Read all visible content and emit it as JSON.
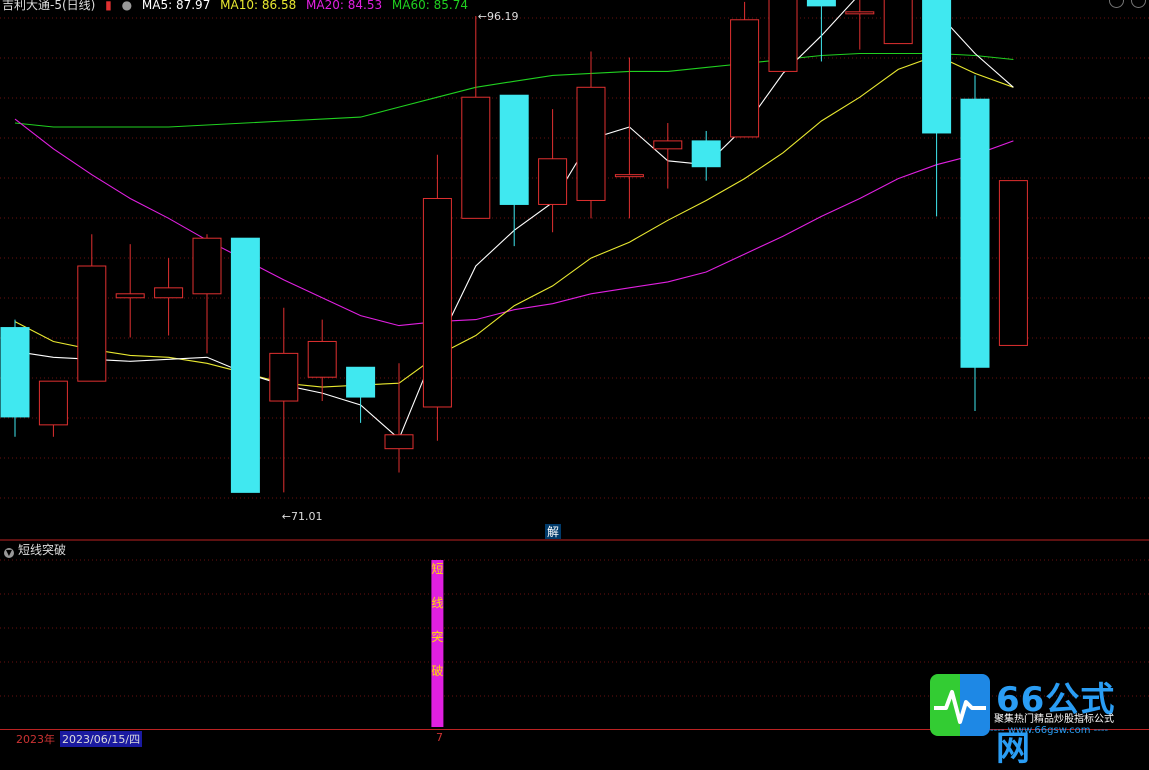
{
  "header": {
    "title": "吉利大通-5(日线)",
    "ma5": "MA5: 87.97",
    "ma10": "MA10: 86.58",
    "ma20": "MA20: 84.53",
    "ma60": "MA60: 85.74"
  },
  "colors": {
    "up": "#e03030",
    "down": "#40e8f0",
    "ma5": "#ffffff",
    "ma10": "#e8e830",
    "ma20": "#e020e0",
    "ma60": "#20d020",
    "grid": "#6a1010",
    "signal": "#e020e0"
  },
  "chart_data": {
    "type": "candlestick",
    "ylim": [
      69,
      97
    ],
    "high_label": "96.19",
    "low_label": "71.01",
    "marker_label": "解",
    "candles": [
      {
        "o": 80.5,
        "c": 76.0,
        "h": 80.9,
        "l": 75.0
      },
      {
        "o": 75.6,
        "c": 77.8,
        "h": 77.8,
        "l": 75.0
      },
      {
        "o": 77.8,
        "c": 83.6,
        "h": 85.2,
        "l": 77.8
      },
      {
        "o": 82.0,
        "c": 82.2,
        "h": 84.7,
        "l": 80.0
      },
      {
        "o": 82.0,
        "c": 82.5,
        "h": 84.0,
        "l": 80.1
      },
      {
        "o": 82.2,
        "c": 85.0,
        "h": 85.2,
        "l": 79.2
      },
      {
        "o": 85.0,
        "c": 72.2,
        "h": 85.0,
        "l": 72.2
      },
      {
        "o": 76.8,
        "c": 79.2,
        "h": 81.5,
        "l": 72.2
      },
      {
        "o": 78.0,
        "c": 79.8,
        "h": 80.9,
        "l": 76.8
      },
      {
        "o": 78.5,
        "c": 77.0,
        "h": 78.5,
        "l": 75.7
      },
      {
        "o": 74.4,
        "c": 75.1,
        "h": 78.7,
        "l": 73.2
      },
      {
        "o": 76.5,
        "c": 87.0,
        "h": 89.2,
        "l": 74.8
      },
      {
        "o": 86.0,
        "c": 92.1,
        "h": 96.19,
        "l": 86.0
      },
      {
        "o": 92.2,
        "c": 86.7,
        "h": 92.2,
        "l": 84.6
      },
      {
        "o": 86.7,
        "c": 89.0,
        "h": 91.5,
        "l": 85.3
      },
      {
        "o": 86.9,
        "c": 92.6,
        "h": 94.4,
        "l": 86.0
      },
      {
        "o": 88.2,
        "c": 88.2,
        "h": 94.1,
        "l": 86.0
      },
      {
        "o": 89.5,
        "c": 89.9,
        "h": 90.8,
        "l": 87.5
      },
      {
        "o": 89.9,
        "c": 88.6,
        "h": 90.4,
        "l": 87.9
      },
      {
        "o": 90.1,
        "c": 96.0,
        "h": 96.9,
        "l": 90.1
      },
      {
        "o": 93.4,
        "c": 98.3,
        "h": 99.0,
        "l": 93.4
      },
      {
        "o": 99.1,
        "c": 96.7,
        "h": 99.1,
        "l": 93.9
      },
      {
        "o": 96.4,
        "c": 96.4,
        "h": 98.6,
        "l": 94.5
      },
      {
        "o": 94.8,
        "c": 98.9,
        "h": 105.0,
        "l": 94.8
      },
      {
        "o": 99.0,
        "c": 90.3,
        "h": 99.0,
        "l": 86.1
      },
      {
        "o": 92.0,
        "c": 78.5,
        "h": 93.2,
        "l": 76.3
      },
      {
        "o": 79.6,
        "c": 87.9,
        "h": 87.9,
        "l": 79.6
      }
    ],
    "ma5": [
      79.3,
      79.0,
      78.9,
      78.8,
      78.9,
      79.0,
      78.2,
      77.6,
      77.2,
      76.6,
      74.9,
      79.6,
      83.6,
      85.4,
      86.8,
      90.0,
      90.6,
      88.9,
      88.7,
      90.6,
      93.3,
      95.2,
      97.3,
      98.3,
      96.4,
      94.3,
      92.6
    ],
    "ma10": [
      80.8,
      79.8,
      79.4,
      79.1,
      79.0,
      78.7,
      78.2,
      77.7,
      77.5,
      77.6,
      77.7,
      79.1,
      80.1,
      81.6,
      82.6,
      84.0,
      84.8,
      85.9,
      86.9,
      88.0,
      89.3,
      90.9,
      92.1,
      93.5,
      94.2,
      93.3,
      92.6
    ],
    "ma20": [
      91.0,
      89.5,
      88.2,
      87.0,
      86.0,
      84.9,
      83.9,
      82.9,
      82.0,
      81.1,
      80.6,
      80.8,
      80.9,
      81.4,
      81.7,
      82.2,
      82.5,
      82.8,
      83.3,
      84.2,
      85.1,
      86.1,
      87.0,
      88.0,
      88.7,
      89.2,
      89.9
    ],
    "ma60": [
      90.8,
      90.6,
      90.6,
      90.6,
      90.6,
      90.7,
      90.8,
      90.9,
      91.0,
      91.1,
      91.6,
      92.1,
      92.6,
      92.9,
      93.2,
      93.3,
      93.4,
      93.4,
      93.6,
      93.8,
      94.0,
      94.2,
      94.3,
      94.3,
      94.3,
      94.2,
      94.0
    ],
    "indicator": {
      "name": "短线突破",
      "signal_index": 11,
      "signal_label": [
        "短",
        "线",
        "突",
        "破"
      ]
    }
  },
  "footer": {
    "year": "2023年",
    "date": "2023/06/15/四",
    "tick": "7"
  },
  "logo": {
    "name": "66公式网",
    "tagline": "聚集热门精品炒股指标公式",
    "url": "---- www.66gsw.com ----"
  }
}
